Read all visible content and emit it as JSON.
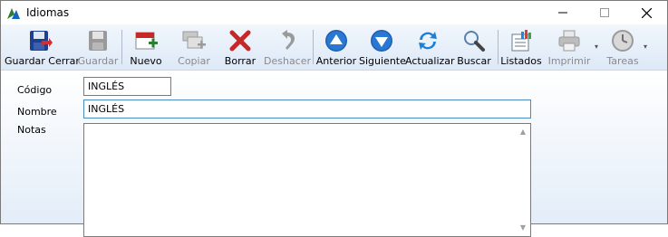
{
  "window": {
    "title": "Idiomas",
    "controls": [
      "minimize",
      "maximize",
      "close"
    ]
  },
  "toolbar": {
    "buttons": [
      {
        "label": "Guardar Cerrar",
        "icon": "save-close-icon",
        "enabled": true
      },
      {
        "label": "Guardar",
        "icon": "save-icon",
        "enabled": false
      },
      {
        "label": "Nuevo",
        "icon": "new-icon",
        "enabled": true
      },
      {
        "label": "Copiar",
        "icon": "copy-icon",
        "enabled": false
      },
      {
        "label": "Borrar",
        "icon": "delete-icon",
        "enabled": true
      },
      {
        "label": "Deshacer",
        "icon": "undo-icon",
        "enabled": false
      },
      {
        "label": "Anterior",
        "icon": "arrow-up-icon",
        "enabled": true
      },
      {
        "label": "Siguiente",
        "icon": "arrow-down-icon",
        "enabled": true
      },
      {
        "label": "Actualizar",
        "icon": "refresh-icon",
        "enabled": true
      },
      {
        "label": "Buscar",
        "icon": "search-icon",
        "enabled": true
      },
      {
        "label": "Listados",
        "icon": "reports-icon",
        "enabled": true
      },
      {
        "label": "Imprimir",
        "icon": "printer-icon",
        "enabled": false
      },
      {
        "label": "Tareas",
        "icon": "clock-icon",
        "enabled": false
      }
    ]
  },
  "form": {
    "codigo": {
      "label": "Código",
      "value": "INGLÉS"
    },
    "nombre": {
      "label": "Nombre",
      "value": "INGLÉS"
    },
    "notas": {
      "label": "Notas",
      "value": ""
    }
  },
  "colors": {
    "accent": "#4a8bc4",
    "toolbar_top": "#f1f6fc",
    "toolbar_bottom": "#dde9f7",
    "disabled_text": "#8a8a8a"
  }
}
